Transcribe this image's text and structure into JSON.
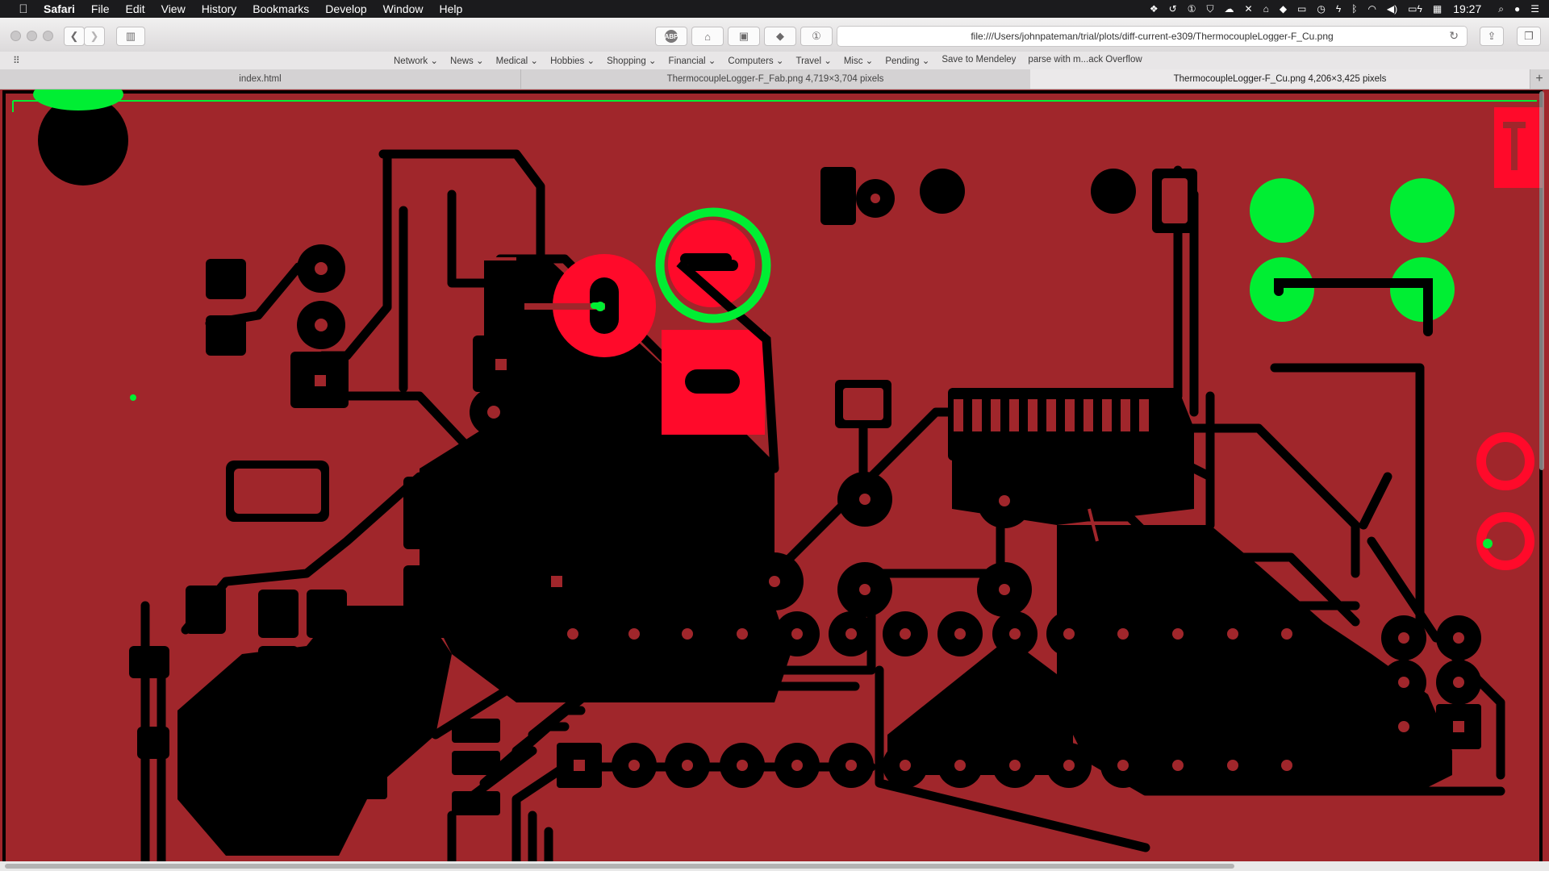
{
  "menubar": {
    "apple": "",
    "app_name": "Safari",
    "items": [
      "File",
      "Edit",
      "View",
      "History",
      "Bookmarks",
      "Develop",
      "Window",
      "Help"
    ],
    "clock": "19:27"
  },
  "toolbar": {
    "url": "file:///Users/johnpateman/trial/plots/diff-current-e309/ThermocoupleLogger-F_Cu.png",
    "abp_label": "ABP"
  },
  "bookmarks": {
    "items": [
      "Network ⌄",
      "News ⌄",
      "Medical ⌄",
      "Hobbies ⌄",
      "Shopping ⌄",
      "Financial ⌄",
      "Computers ⌄",
      "Travel ⌄",
      "Misc ⌄",
      "Pending ⌄",
      "Save to Mendeley",
      "parse with m...ack Overflow"
    ]
  },
  "tabs": [
    {
      "label": "index.html",
      "active": false
    },
    {
      "label": "ThermocoupleLogger-F_Fab.png 4,719×3,704 pixels",
      "active": false
    },
    {
      "label": "ThermocoupleLogger-F_Cu.png 4,206×3,425 pixels",
      "active": true
    }
  ],
  "colors": {
    "board": "#a0262b",
    "copper": "#000000",
    "added": "#00ee33",
    "removed": "#ff0a2a"
  }
}
